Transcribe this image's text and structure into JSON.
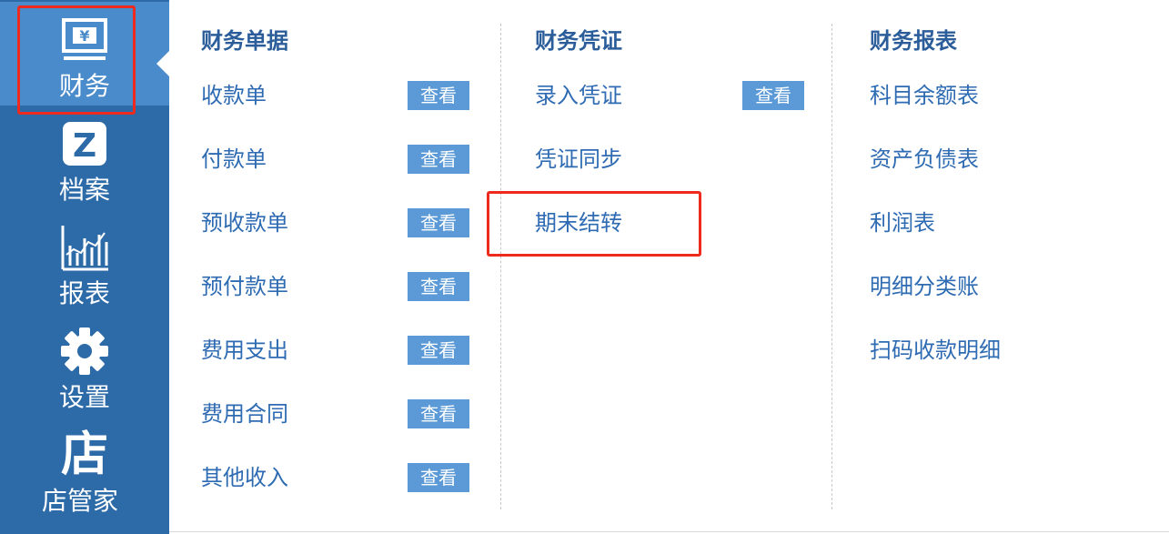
{
  "sidebar": {
    "items": [
      {
        "label": "财务",
        "icon": "monitor-yen-icon"
      },
      {
        "label": "档案",
        "icon": "z-badge-icon"
      },
      {
        "label": "报表",
        "icon": "bar-chart-icon"
      },
      {
        "label": "设置",
        "icon": "gear-icon"
      },
      {
        "label": "店管家",
        "icon": "store-character-icon",
        "glyph": "店"
      }
    ],
    "active": "财务",
    "colors": {
      "background": "#2d6aa8",
      "active": "#4a8bcb"
    }
  },
  "columns": {
    "documents": {
      "title": "财务单据",
      "items": [
        {
          "label": "收款单",
          "action": "查看"
        },
        {
          "label": "付款单",
          "action": "查看"
        },
        {
          "label": "预收款单",
          "action": "查看"
        },
        {
          "label": "预付款单",
          "action": "查看"
        },
        {
          "label": "费用支出",
          "action": "查看"
        },
        {
          "label": "费用合同",
          "action": "查看"
        },
        {
          "label": "其他收入",
          "action": "查看"
        }
      ]
    },
    "vouchers": {
      "title": "财务凭证",
      "items": [
        {
          "label": "录入凭证",
          "action": "查看"
        },
        {
          "label": "凭证同步"
        },
        {
          "label": "期末结转"
        }
      ]
    },
    "reports": {
      "title": "财务报表",
      "items": [
        {
          "label": "科目余额表"
        },
        {
          "label": "资产负债表"
        },
        {
          "label": "利润表"
        },
        {
          "label": "明细分类账"
        },
        {
          "label": "扫码收款明细"
        }
      ]
    }
  },
  "accent": {
    "link": "#2e6bb3",
    "button": "#5b9ad6",
    "highlight": "#ee2a1e"
  }
}
